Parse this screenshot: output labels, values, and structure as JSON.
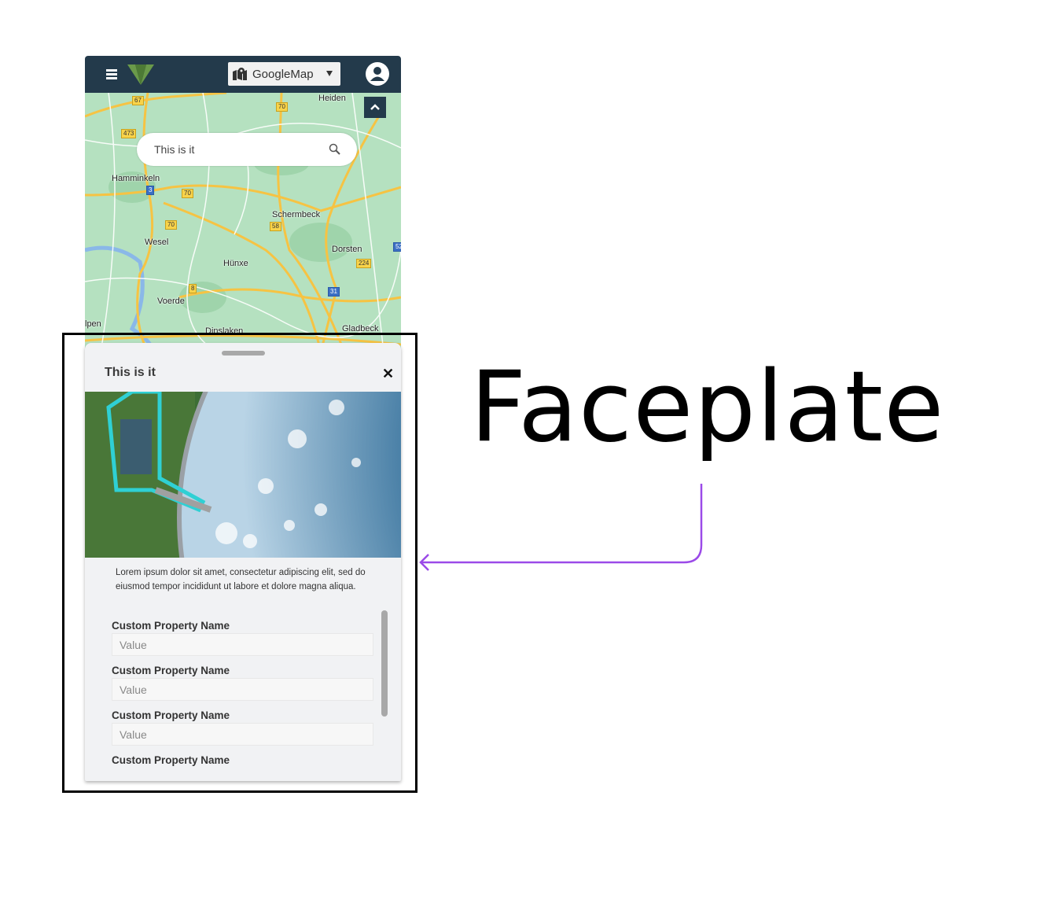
{
  "header": {
    "menu_icon": "hamburger-icon",
    "map_selector": {
      "icon": "map-marker-icon",
      "selected": "GoogleMap"
    },
    "user_icon": "user-avatar-icon"
  },
  "map": {
    "search": {
      "value": "This is it"
    },
    "labels": [
      "Hamminkeln",
      "Schermbeck",
      "Wesel",
      "Hünxe",
      "Dorsten",
      "Voerde",
      "Dinslaken",
      "Gladbeck",
      "lpen",
      "Heiden"
    ],
    "shields": [
      "67",
      "473",
      "70",
      "70",
      "3",
      "70",
      "58",
      "8",
      "224",
      "31",
      "52"
    ]
  },
  "faceplate": {
    "title": "This is it",
    "description": "Lorem ipsum dolor sit amet, consectetur adipiscing elit, sed do eiusmod tempor incididunt ut labore et dolore magna aliqua.",
    "properties": [
      {
        "name": "Custom Property Name",
        "value": "Value"
      },
      {
        "name": "Custom Property Name",
        "value": "Value"
      },
      {
        "name": "Custom Property Name",
        "value": "Value"
      },
      {
        "name": "Custom Property Name",
        "value": ""
      }
    ]
  },
  "annotation": {
    "label": "Faceplate",
    "arrow_color": "#9b4ae8"
  },
  "colors": {
    "header": "#233a4b",
    "logo": "#6a9a4a",
    "map": "#b5e1c0"
  }
}
